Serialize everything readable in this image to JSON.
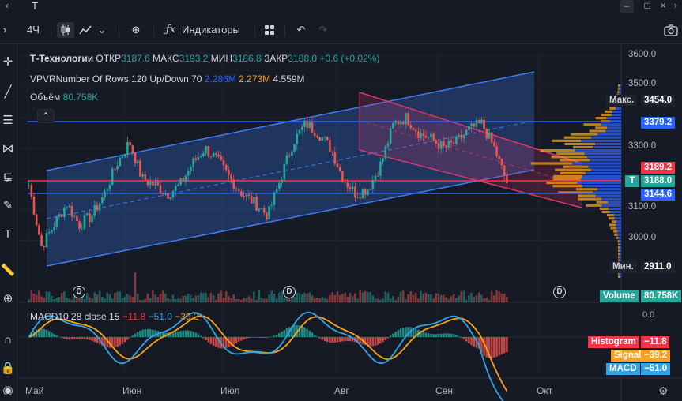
{
  "window": {
    "symbol_text": "T",
    "minimize": "–",
    "maximize": "□",
    "close": "×"
  },
  "toolbar": {
    "timeframe": "4Ч",
    "indicators_label": "Индикаторы"
  },
  "legend": {
    "title": "Т-Технологии",
    "open_label": "ОТКР",
    "open_value": "3187.6",
    "high_label": "МАКС",
    "high_value": "3193.2",
    "low_label": "МИН",
    "low_value": "3186.8",
    "close_label": "ЗАКР",
    "close_value": "3188.0",
    "change": "+0.6 (+0.02%)",
    "vpvr_name": "VPVRNumber Of Rows 120 Up/Down 70",
    "vpvr_up": "2.286M",
    "vpvr_down": "2.273M",
    "vpvr_total": "4.559M",
    "volume_label": "Объём",
    "volume_value": "80.758K"
  },
  "macd_legend": {
    "name": "MACD",
    "params": "10 28 close 15",
    "histogram": "−11.8",
    "macd": "−51.0",
    "signal": "−39.2"
  },
  "price_scale": {
    "ticks": [
      "3600.0",
      "3500.0",
      "3400.0",
      "3300.0",
      "3200.0",
      "3100.0",
      "3000.0"
    ],
    "max_label": "Макс.",
    "max_value": "3454.0",
    "level_upper": "3379.2",
    "level_mid": "3189.2",
    "symbol_badge": "T",
    "last_price": "3188.0",
    "level_lower": "3144.6",
    "min_label": "Мин.",
    "min_value": "2911.0",
    "volume_label": "Volume",
    "volume_value": "80.758K"
  },
  "macd_scale": {
    "tick": "0.0",
    "histogram_label": "Histogram",
    "histogram_value": "−11.8",
    "signal_label": "Signal",
    "signal_value": "−39.2",
    "macd_label": "MACD",
    "macd_value": "−51.0"
  },
  "time_axis": {
    "labels": [
      "Май",
      "Июн",
      "Июл",
      "Авг",
      "Сен",
      "Окт"
    ]
  },
  "dividend_mark": "D",
  "colors": {
    "background": "#161a25",
    "up": "#26a69a",
    "down": "#ef5350",
    "channel": "#3d7cf2",
    "down_channel": "#e0356d",
    "vpvr_up": "#2962ff",
    "vpvr_down": "#f7a21b",
    "macd": "#2fa4e7",
    "signal": "#f7a21b",
    "red_level": "#f23645",
    "blue_level": "#2962ff"
  },
  "chart_data": {
    "type": "candlestick",
    "timeframe": "4Ч",
    "x_labels": [
      "Май",
      "Июн",
      "Июл",
      "Авг",
      "Сен",
      "Окт"
    ],
    "y_range": [
      2911.0,
      3600.0
    ],
    "y_ticks": [
      3000,
      3100,
      3200,
      3300,
      3400,
      3500,
      3600
    ],
    "approx_closes": [
      3180,
      2980,
      3050,
      3120,
      3050,
      3080,
      3150,
      3250,
      3320,
      3200,
      3180,
      3150,
      3180,
      3250,
      3300,
      3260,
      3200,
      3150,
      3120,
      3080,
      3200,
      3320,
      3380,
      3350,
      3300,
      3200,
      3150,
      3170,
      3250,
      3380,
      3400,
      3350,
      3330,
      3300,
      3320,
      3360,
      3380,
      3300,
      3188
    ],
    "levels": [
      3454.0,
      3379.2,
      3189.2,
      3188.0,
      3144.6,
      2911.0
    ],
    "macd_series": {
      "macd_last": -51.0,
      "signal_last": -39.2,
      "histogram_last": -11.8
    }
  }
}
